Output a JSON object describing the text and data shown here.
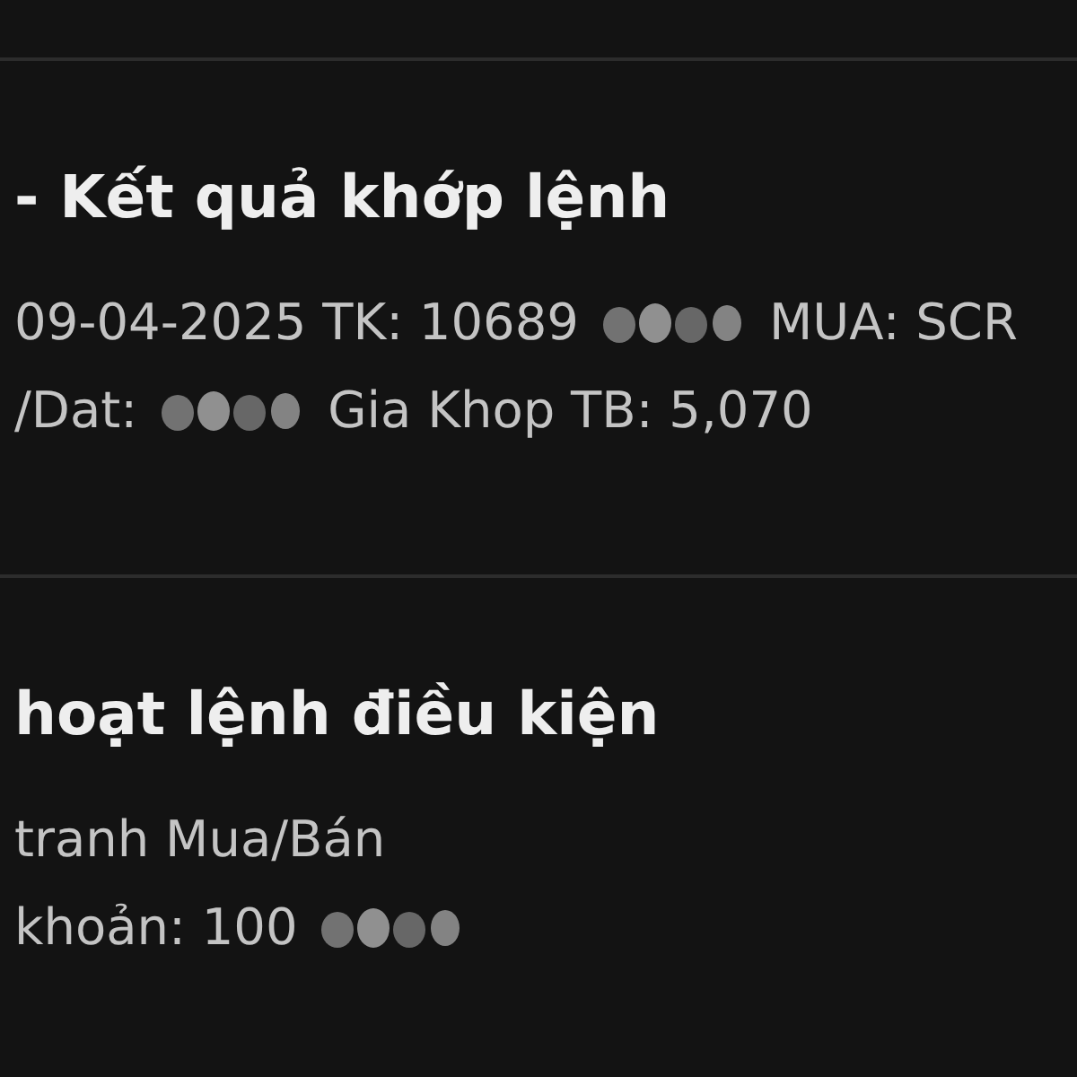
{
  "notifications": [
    {
      "title": "- Kết quả khớp lệnh",
      "lines": [
        [
          {
            "kind": "text",
            "text": "09-04-2025 TK: 10689"
          },
          {
            "kind": "redacted"
          },
          {
            "kind": "text",
            "text": "MUA: SCR"
          }
        ],
        [
          {
            "kind": "text",
            "text": "/Dat:"
          },
          {
            "kind": "redacted"
          },
          {
            "kind": "text",
            "text": "Gia Khop TB: 5,070"
          }
        ]
      ]
    },
    {
      "title": "hoạt lệnh điều kiện",
      "lines": [
        [
          {
            "kind": "text",
            "text": "tranh Mua/Bán"
          }
        ],
        [
          {
            "kind": "text",
            "text": "khoản: 100"
          },
          {
            "kind": "redacted"
          }
        ]
      ]
    }
  ]
}
